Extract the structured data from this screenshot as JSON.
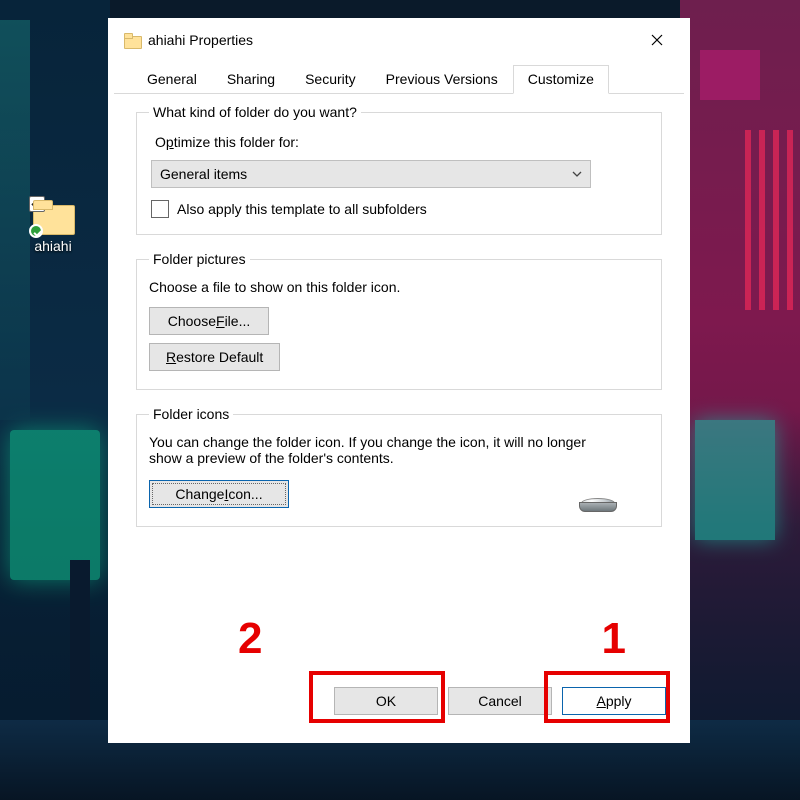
{
  "desktop": {
    "icon_label": "ahiahi"
  },
  "dialog": {
    "title": "ahiahi Properties",
    "tabs": [
      "General",
      "Sharing",
      "Security",
      "Previous Versions",
      "Customize"
    ],
    "active_tab": "Customize",
    "section_kind": {
      "legend": "What kind of folder do you want?",
      "optimize_label": "Optimize this folder for:",
      "combo_value": "General items",
      "subfolders_label": "Also apply this template to all subfolders"
    },
    "section_pictures": {
      "legend": "Folder pictures",
      "description": "Choose a file to show on this folder icon.",
      "choose_btn": "Choose File...",
      "restore_btn": "Restore Default"
    },
    "section_icons": {
      "legend": "Folder icons",
      "description": "You can change the folder icon. If you change the icon, it will no longer show a preview of the folder's contents.",
      "change_btn": "Change Icon..."
    },
    "footer": {
      "ok": "OK",
      "cancel": "Cancel",
      "apply": "Apply"
    }
  },
  "annotations": {
    "one": "1",
    "two": "2"
  }
}
